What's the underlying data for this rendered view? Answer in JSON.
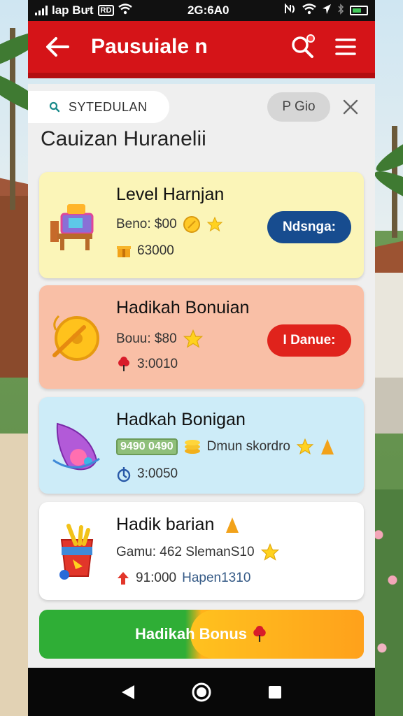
{
  "status_bar": {
    "carrier": "lap Bưt",
    "indicator": "RD",
    "time": "2G:6A0"
  },
  "app_bar": {
    "title": "Pausuiale n"
  },
  "search": {
    "chip_label": "SYTEDULAN",
    "pill_label": "P Gio"
  },
  "section_title": "Cauizan Huranelii",
  "cards": [
    {
      "title": "Level Harnjan",
      "line1": "Beno: $00",
      "line2": "63000",
      "button": "Ndsnga:"
    },
    {
      "title": "Hadikah Bonuian",
      "line1": "Bouu: $80",
      "line2": "3:0010",
      "button": "I Danue:"
    },
    {
      "title": "Hadkah Bonigan",
      "tag": "9490 0490",
      "line1": "Dmun skordro",
      "line2": "3:0050"
    },
    {
      "title": "Hadik barian",
      "line1": "Gamu: 462 SlemanS10",
      "line2a": "91:000",
      "line2b": "Hapen1310"
    }
  ],
  "cta": {
    "label_left": "Hadikah",
    "label_right": "Bonus"
  },
  "colors": {
    "app_bar": "#d51418",
    "button_blue": "#174c8f",
    "button_red": "#e0231c",
    "card_yellow": "#fbf5b8",
    "card_salmon": "#f9bfa6",
    "card_blue": "#cdecf8",
    "cta_green": "#2fae36",
    "cta_orange": "#ff9a1a"
  },
  "icons": {
    "back": "back-arrow-icon",
    "search": "search-icon",
    "menu": "hamburger-menu-icon",
    "close": "close-icon",
    "nav_back": "nav-back-icon",
    "nav_home": "nav-home-icon",
    "nav_recents": "nav-recents-icon"
  }
}
